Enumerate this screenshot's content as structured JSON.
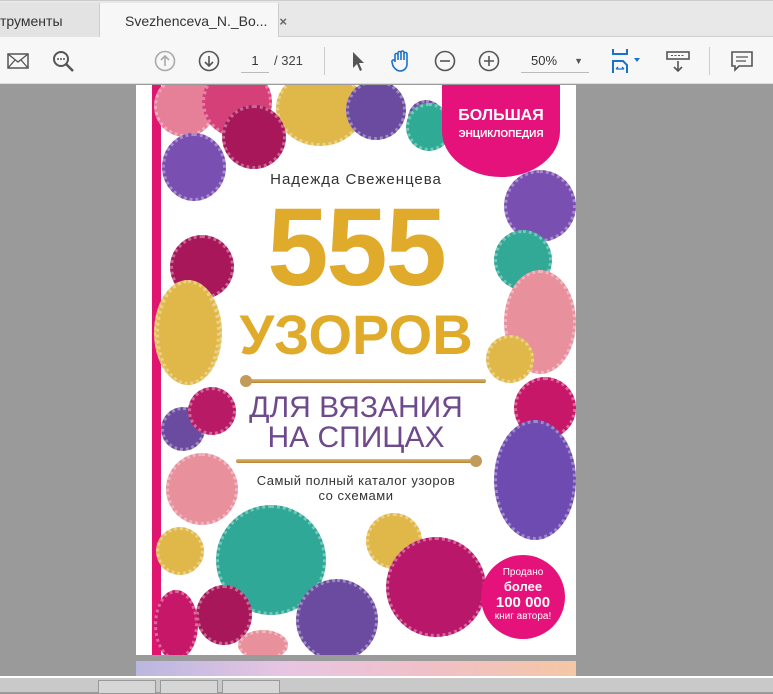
{
  "tabs": [
    {
      "label": "трументы"
    },
    {
      "label": "Svezhenceva_N._Bo...",
      "close": "×"
    }
  ],
  "toolbar": {
    "page_current": "1",
    "page_total": "/ 321",
    "zoom": "50%"
  },
  "cover": {
    "badge_line1": "БОЛЬШАЯ",
    "badge_line2": "ЭНЦИКЛОПЕДИЯ",
    "author": "Надежда Свеженцева",
    "number": "555",
    "title": "УЗОРОВ",
    "subtitle1": "ДЛЯ ВЯЗАНИЯ",
    "subtitle2": "НА СПИЦАХ",
    "tagline1": "Самый полный каталог узоров",
    "tagline2": "со схемами",
    "sold1": "Продано",
    "sold2": "более",
    "sold3": "100 000",
    "sold4": "книг автора!"
  },
  "colors": {
    "magenta": "#e4127a",
    "gold": "#e0aa2a",
    "purple": "#6e4a8c"
  }
}
